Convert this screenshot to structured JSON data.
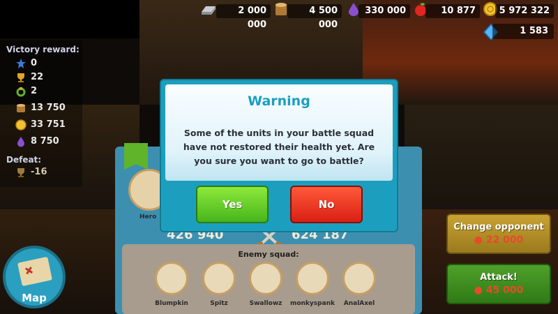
{
  "resources": {
    "iron": "2 000 000",
    "wood": "4 500 000",
    "mana": "330 000",
    "food": "10 877",
    "gold": "5 972 322",
    "gems": "1 583"
  },
  "reward_panel": {
    "victory_label": "Victory reward:",
    "items": [
      {
        "icon": "star-badge-icon",
        "value": "0"
      },
      {
        "icon": "trophy-icon",
        "value": "22"
      },
      {
        "icon": "laurel-icon",
        "value": "2"
      },
      {
        "icon": "wood-log-icon",
        "value": "13 750"
      },
      {
        "icon": "gold-coin-icon",
        "value": "33 751"
      },
      {
        "icon": "mana-drop-icon",
        "value": "8 750"
      }
    ],
    "defeat_label": "Defeat:",
    "defeat_value": "-16"
  },
  "squad": {
    "hero_label": "Hero",
    "player_power": "426 940",
    "enemy_power": "624 187",
    "enemy_label": "Enemy squad:",
    "enemies": [
      "Blumpkin",
      "Spitz",
      "Swallowz",
      "monkyspank",
      "AnalAxel"
    ]
  },
  "actions": {
    "change_opponent_label": "Change opponent",
    "change_opponent_cost": "22 000",
    "attack_label": "Attack!",
    "attack_cost": "45 000",
    "map_label": "Map"
  },
  "modal": {
    "title": "Warning",
    "message": "Some of the units in your battle squad have not restored their health yet. Are you sure you want to go to battle?",
    "yes_label": "Yes",
    "no_label": "No"
  },
  "colors": {
    "accent": "#1c9fbf",
    "yes_green": "#46b51c",
    "no_red": "#d91f14"
  }
}
